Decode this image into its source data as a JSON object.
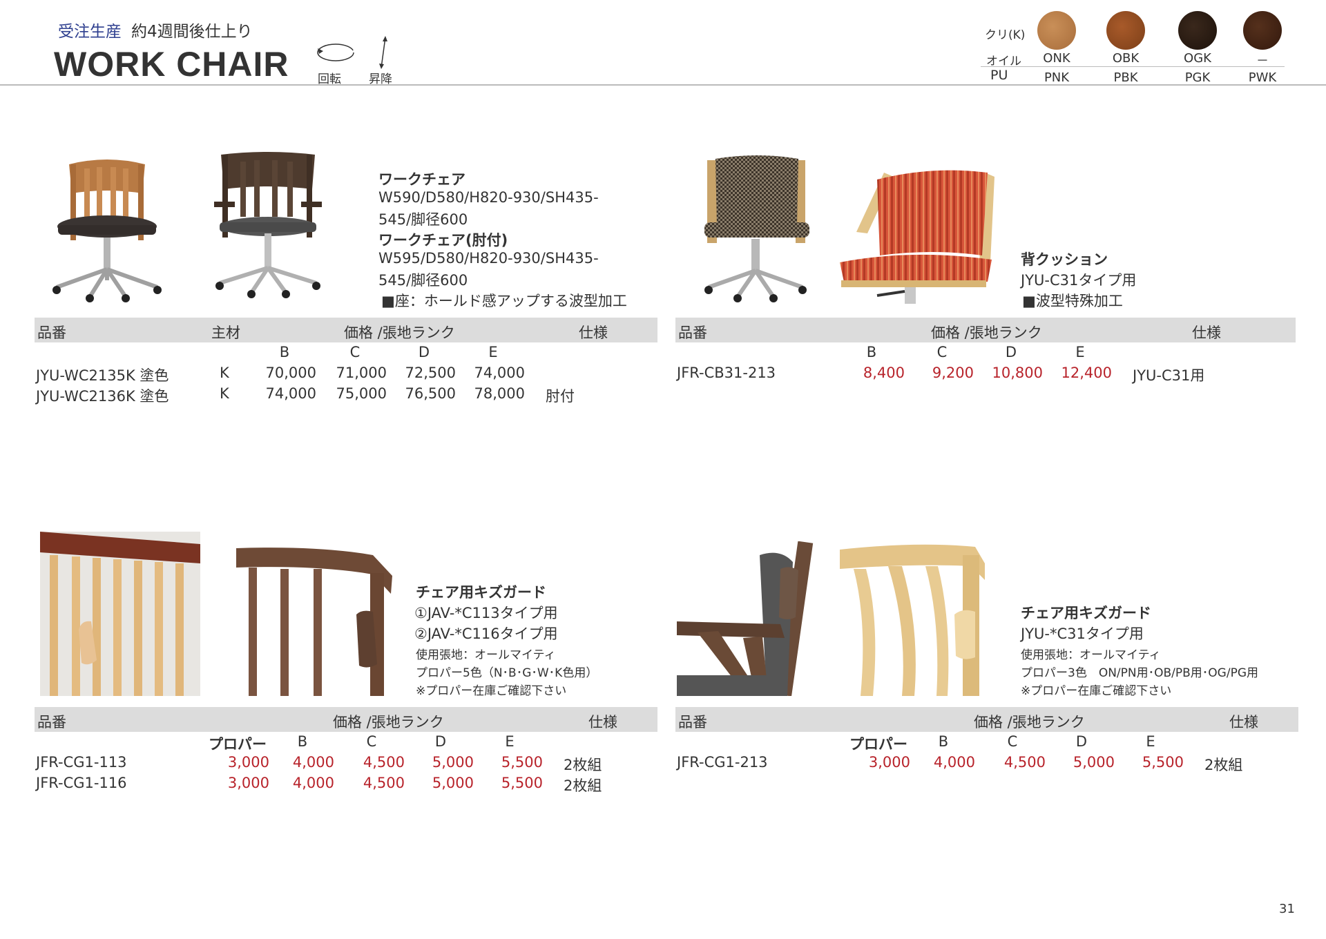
{
  "header": {
    "production_type": "受注生産",
    "lead_time": "約4週間後仕上り",
    "title": "WORK CHAIR",
    "rotate_label": "回転",
    "lift_label": "昇降"
  },
  "finish": {
    "wood_label": "クリ(K)",
    "oil_label": "オイル",
    "pu_label": "PU",
    "swatches": [
      {
        "color": "#b57a45",
        "oil": "ONK",
        "pu": "PNK"
      },
      {
        "color": "#8f4a1f",
        "oil": "OBK",
        "pu": "PBK"
      },
      {
        "color": "#2a1b12",
        "oil": "OGK",
        "pu": "PGK"
      },
      {
        "color": "#3e2214",
        "oil": "－",
        "pu": "PWK"
      }
    ]
  },
  "sections": {
    "work_chair": {
      "name1": "ワークチェア",
      "dims1_line1": "W590/D580/H820-930/SH435-",
      "dims1_line2": "545/脚径600",
      "name2": "ワークチェア(肘付)",
      "dims2_line1": "W595/D580/H820-930/SH435-",
      "dims2_line2": "545/脚径600",
      "feature": "■座：ホールド感アップする波型加工",
      "table": {
        "h_code": "品番",
        "h_material": "主材",
        "h_price": "価格 /張地ランク",
        "h_spec": "仕様",
        "ranks": [
          "B",
          "C",
          "D",
          "E"
        ],
        "rows": [
          {
            "code": "JYU-WC2135K 塗色",
            "material": "K",
            "prices": [
              "70,000",
              "71,000",
              "72,500",
              "74,000"
            ],
            "spec": ""
          },
          {
            "code": "JYU-WC2136K 塗色",
            "material": "K",
            "prices": [
              "74,000",
              "75,000",
              "76,500",
              "78,000"
            ],
            "spec": "肘付"
          }
        ]
      }
    },
    "back_cushion": {
      "name": "背クッション",
      "type": "JYU-C31タイプ用",
      "feature": "■波型特殊加工",
      "table": {
        "h_code": "品番",
        "h_price": "価格 /張地ランク",
        "h_spec": "仕様",
        "ranks": [
          "B",
          "C",
          "D",
          "E"
        ],
        "rows": [
          {
            "code": "JFR-CB31-213",
            "prices": [
              "8,400",
              "9,200",
              "10,800",
              "12,400"
            ],
            "spec": "JYU-C31用"
          }
        ]
      }
    },
    "kids_guard_1": {
      "name": "チェア用キズガード",
      "type1": "①JAV-*C113タイプ用",
      "type2": "②JAV-*C116タイプ用",
      "fabric": "使用張地：オールマイティ",
      "proper": "プロパー5色（N･B･G･W･K色用）",
      "note": "※プロパー在庫ご確認下さい",
      "table": {
        "h_code": "品番",
        "h_price": "価格 /張地ランク",
        "h_spec": "仕様",
        "proper_label": "プロパー",
        "ranks": [
          "B",
          "C",
          "D",
          "E"
        ],
        "rows": [
          {
            "code": "JFR-CG1-113",
            "proper": "3,000",
            "prices": [
              "4,000",
              "4,500",
              "5,000",
              "5,500"
            ],
            "spec": "2枚組"
          },
          {
            "code": "JFR-CG1-116",
            "proper": "3,000",
            "prices": [
              "4,000",
              "4,500",
              "5,000",
              "5,500"
            ],
            "spec": "2枚組"
          }
        ]
      }
    },
    "kids_guard_2": {
      "name": "チェア用キズガード",
      "type": "JYU-*C31タイプ用",
      "fabric": "使用張地：オールマイティ",
      "proper": "プロパー3色　ON/PN用･OB/PB用･OG/PG用",
      "note": "※プロパー在庫ご確認下さい",
      "table": {
        "h_code": "品番",
        "h_price": "価格 /張地ランク",
        "h_spec": "仕様",
        "proper_label": "プロパー",
        "ranks": [
          "B",
          "C",
          "D",
          "E"
        ],
        "rows": [
          {
            "code": "JFR-CG1-213",
            "proper": "3,000",
            "prices": [
              "4,000",
              "4,500",
              "5,000",
              "5,500"
            ],
            "spec": "2枚組"
          }
        ]
      }
    }
  },
  "page_number": "31"
}
